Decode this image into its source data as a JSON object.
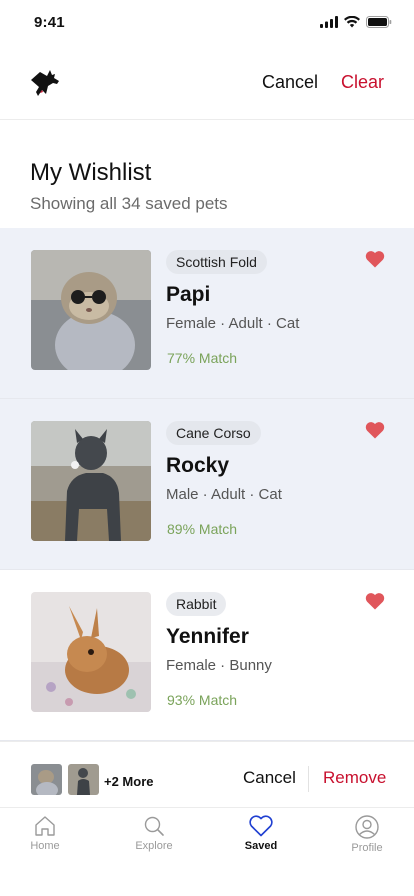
{
  "status_bar": {
    "time": "9:41"
  },
  "header": {
    "cancel_label": "Cancel",
    "clear_label": "Clear"
  },
  "page": {
    "title": "My Wishlist",
    "subtitle": "Showing all 34 saved pets"
  },
  "pets": [
    {
      "breed": "Scottish Fold",
      "name": "Papi",
      "details": "Female · Adult · Cat",
      "match": "77% Match",
      "favorited": true,
      "selected": true
    },
    {
      "breed": "Cane Corso",
      "name": "Rocky",
      "details": "Male · Adult · Cat",
      "match": "89% Match",
      "favorited": true,
      "selected": true
    },
    {
      "breed": "Rabbit",
      "name": "Yennifer",
      "details": "Female · Bunny",
      "match": "93% Match",
      "favorited": true,
      "selected": false
    }
  ],
  "action_bar": {
    "more_label": "+2 More",
    "cancel_label": "Cancel",
    "remove_label": "Remove"
  },
  "tabs": [
    {
      "label": "Home",
      "icon": "home-icon",
      "active": false
    },
    {
      "label": "Explore",
      "icon": "search-icon",
      "active": false
    },
    {
      "label": "Saved",
      "icon": "heart-icon",
      "active": true
    },
    {
      "label": "Profile",
      "icon": "profile-icon",
      "active": false
    }
  ],
  "colors": {
    "accent_red": "#c8102e",
    "heart": "#e0565b",
    "match_green": "#7aa35a",
    "selected_bg": "#eef1f8",
    "active_tab": "#1f3fd1"
  }
}
